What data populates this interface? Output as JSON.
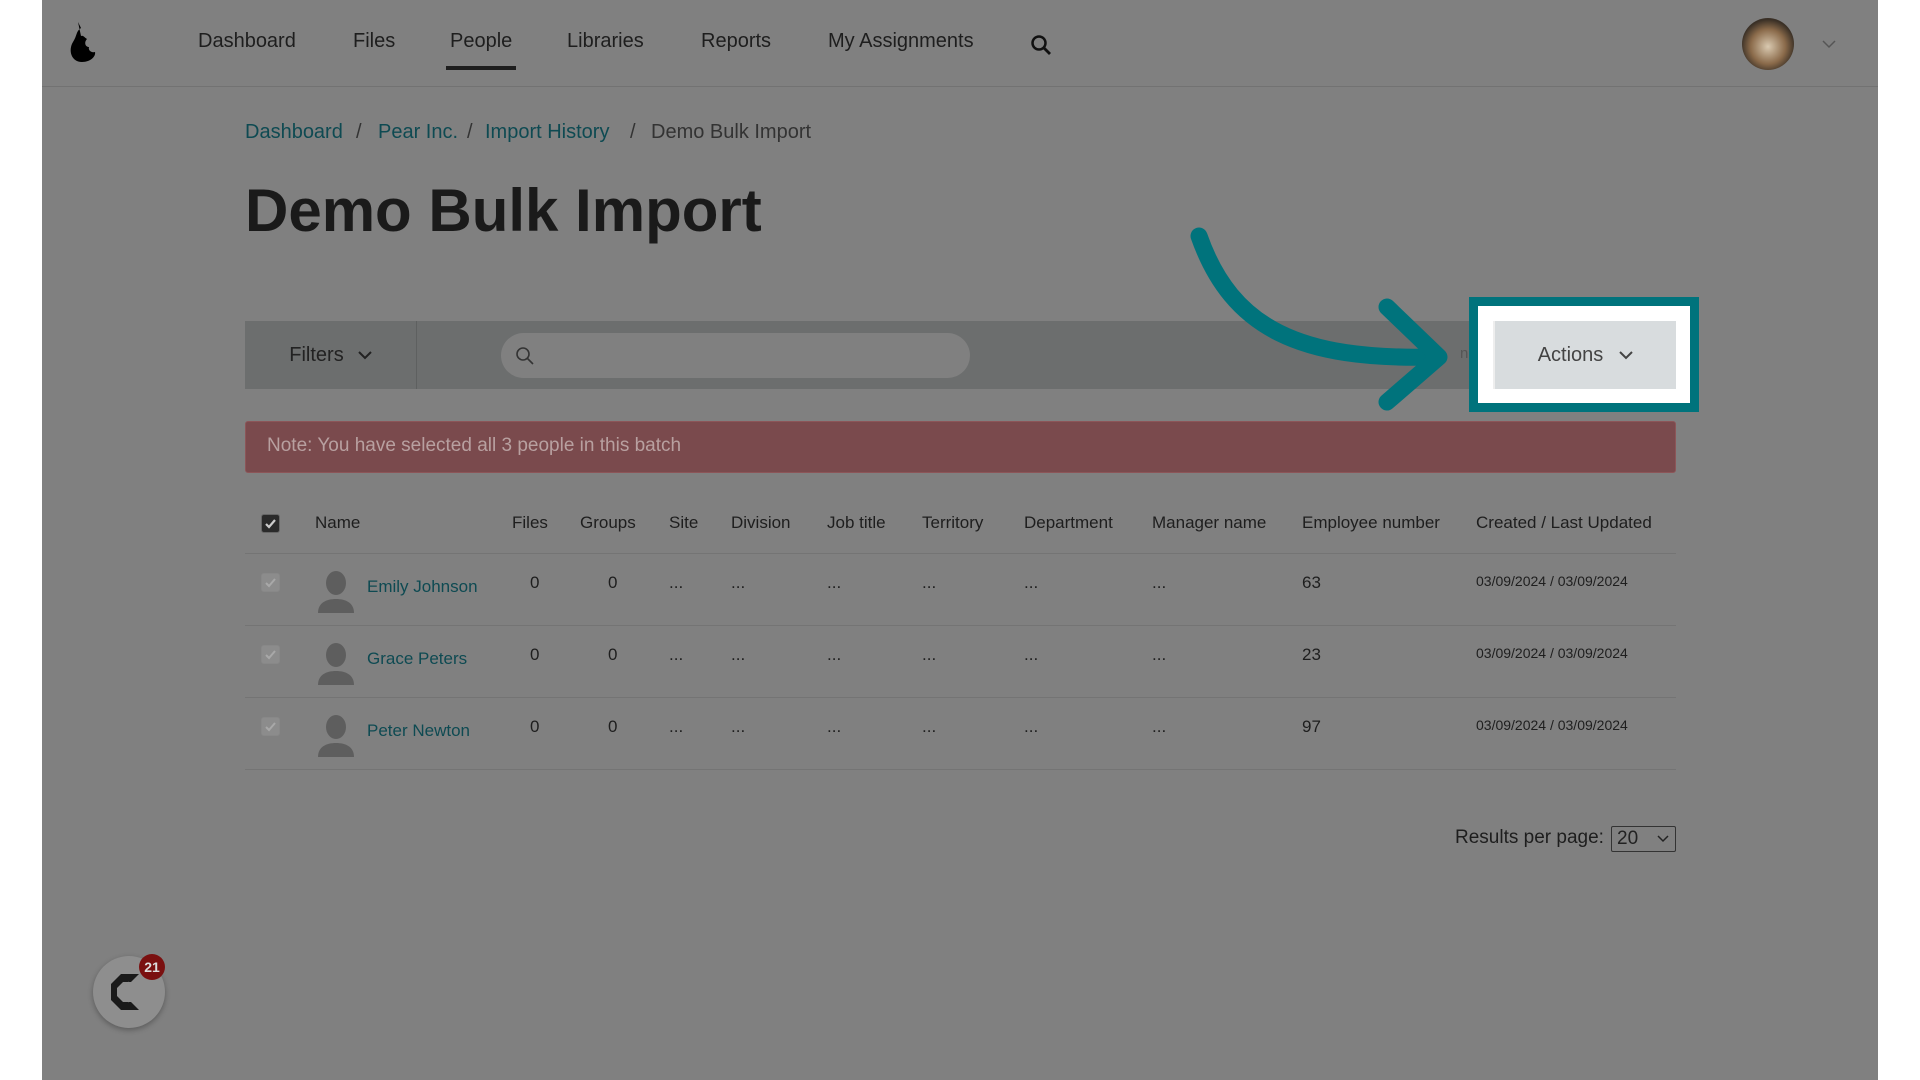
{
  "nav": {
    "items": [
      "Dashboard",
      "Files",
      "People",
      "Libraries",
      "Reports",
      "My Assignments"
    ],
    "active": "People"
  },
  "breadcrumb": [
    "Dashboard",
    "Pear Inc.",
    "Import History",
    "Demo Bulk Import"
  ],
  "page_title": "Demo Bulk Import",
  "toolbar": {
    "filters_label": "Filters",
    "search_placeholder": "",
    "hidden_text": "nd",
    "actions_label": "Actions"
  },
  "note": "Note: You have selected all 3 people in this batch",
  "table": {
    "headers": [
      "Name",
      "Files",
      "Groups",
      "Site",
      "Division",
      "Job title",
      "Territory",
      "Department",
      "Manager name",
      "Employee number",
      "Created / Last Updated"
    ],
    "rows": [
      {
        "name": "Emily Johnson",
        "files": "0",
        "groups": "0",
        "site": "...",
        "division": "...",
        "job": "...",
        "territory": "...",
        "department": "...",
        "manager": "...",
        "employee": "63",
        "dates": "03/09/2024 / 03/09/2024"
      },
      {
        "name": "Grace Peters",
        "files": "0",
        "groups": "0",
        "site": "...",
        "division": "...",
        "job": "...",
        "territory": "...",
        "department": "...",
        "manager": "...",
        "employee": "23",
        "dates": "03/09/2024 / 03/09/2024"
      },
      {
        "name": "Peter Newton",
        "files": "0",
        "groups": "0",
        "site": "...",
        "division": "...",
        "job": "...",
        "territory": "...",
        "department": "...",
        "manager": "...",
        "employee": "97",
        "dates": "03/09/2024 / 03/09/2024"
      }
    ]
  },
  "pagination": {
    "label": "Results per page:",
    "value": "20"
  },
  "chat": {
    "badge": "21"
  },
  "colors": {
    "highlight": "#00737c",
    "overlay": "#808080",
    "note": "#7a4a4d"
  }
}
